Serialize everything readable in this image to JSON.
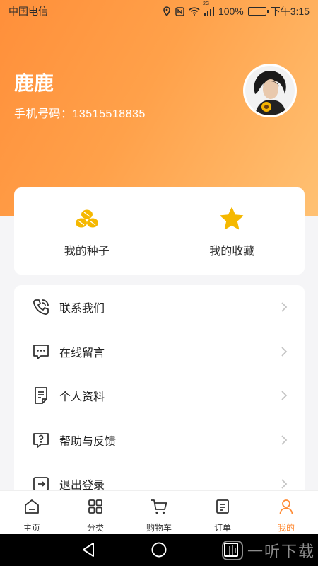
{
  "status_bar": {
    "carrier": "中国电信",
    "network": "2G",
    "battery": "100%",
    "time": "下午3:15"
  },
  "profile": {
    "name": "鹿鹿",
    "phone": "手机号码：13515518835"
  },
  "quick_actions": [
    {
      "label": "我的种子",
      "icon": "seed-icon"
    },
    {
      "label": "我的收藏",
      "icon": "star-icon"
    }
  ],
  "menu": [
    {
      "label": "联系我们",
      "icon": "phone-icon"
    },
    {
      "label": "在线留言",
      "icon": "message-icon"
    },
    {
      "label": "个人资料",
      "icon": "document-icon"
    },
    {
      "label": "帮助与反馈",
      "icon": "help-icon"
    },
    {
      "label": "退出登录",
      "icon": "logout-icon"
    }
  ],
  "tabbar": [
    {
      "label": "主页",
      "icon": "home-icon",
      "active": false
    },
    {
      "label": "分类",
      "icon": "grid-icon",
      "active": false
    },
    {
      "label": "购物车",
      "icon": "cart-icon",
      "active": false
    },
    {
      "label": "订单",
      "icon": "order-icon",
      "active": false
    },
    {
      "label": "我的",
      "icon": "user-icon",
      "active": true
    }
  ],
  "watermark": "一听下载",
  "colors": {
    "accent": "#ff8a33",
    "hero_start": "#ff8f3a",
    "hero_end": "#ffc173",
    "icon_gold": "#f5b800"
  }
}
